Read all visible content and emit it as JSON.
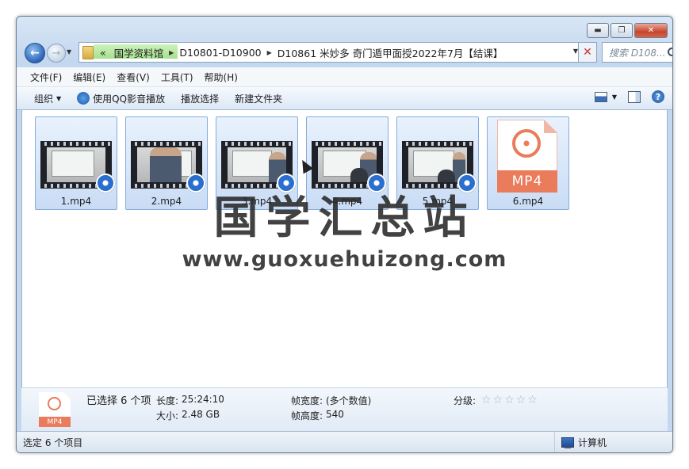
{
  "window": {
    "controls": {
      "minimize": "▬",
      "maximize": "❐",
      "close": "✕"
    }
  },
  "address": {
    "overflow": "«",
    "crumbs": [
      "国学资料馆",
      "D10801-D10900",
      "D10861 米妙多 奇门遁甲面授2022年7月【结课】"
    ],
    "search_placeholder": "搜索 D108..."
  },
  "menu": [
    "文件(F)",
    "编辑(E)",
    "查看(V)",
    "工具(T)",
    "帮助(H)"
  ],
  "toolbar": {
    "organize": "组织",
    "play_qq": "使用QQ影音播放",
    "play_selected": "播放选择",
    "new_folder": "新建文件夹"
  },
  "files": [
    {
      "name": "1.mp4",
      "type": "video"
    },
    {
      "name": "2.mp4",
      "type": "video"
    },
    {
      "name": "3.mp4",
      "type": "video"
    },
    {
      "name": "4.mp4",
      "type": "video"
    },
    {
      "name": "5.mp4",
      "type": "video"
    },
    {
      "name": "6.mp4",
      "type": "mp4-icon",
      "badge": "MP4"
    }
  ],
  "watermark": {
    "title": "国学汇总站",
    "url": "www.guoxuehuizong.com"
  },
  "details": {
    "icon_label": "MP4",
    "selected": "已选择 6 个项",
    "length_label": "长度:",
    "length_value": "25:24:10",
    "size_label": "大小:",
    "size_value": "2.48 GB",
    "frame_width_label": "帧宽度:",
    "frame_width_value": "(多个数值)",
    "frame_height_label": "帧高度:",
    "frame_height_value": "540",
    "rating_label": "分级:",
    "rating_stars": "☆☆☆☆☆"
  },
  "status": {
    "left": "选定 6 个项目",
    "right": "计算机"
  },
  "colors": {
    "accent": "#2a6fd0",
    "mp4_orange": "#ea7b5b",
    "selection": "#c9dcf5"
  }
}
